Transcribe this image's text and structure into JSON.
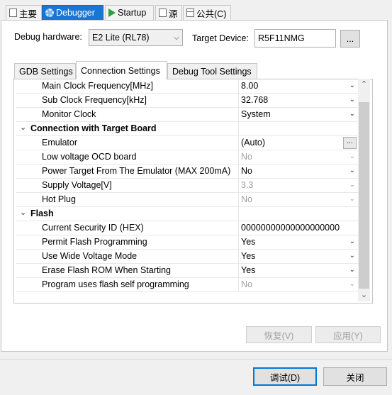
{
  "top_tabs": [
    {
      "label": "主要",
      "icon": "document-icon",
      "active": false
    },
    {
      "label": "Debugger",
      "icon": "bug-gear-icon",
      "active": true
    },
    {
      "label": "Startup",
      "icon": "play-icon",
      "active": false
    },
    {
      "label": "源",
      "icon": "document-icon",
      "active": false
    },
    {
      "label": "公共(C)",
      "icon": "grid-icon",
      "active": false
    }
  ],
  "debug_hardware": {
    "label": "Debug hardware:",
    "value": "E2 Lite (RL78)"
  },
  "target_device": {
    "label": "Target Device:",
    "value": "R5F11NMG",
    "browse_label": "..."
  },
  "inner_tabs": [
    {
      "label": "GDB Settings",
      "active": false
    },
    {
      "label": "Connection Settings",
      "active": true
    },
    {
      "label": "Debug Tool Settings",
      "active": false
    }
  ],
  "rows": [
    {
      "type": "prop",
      "name": "Main Clock Frequency[MHz]",
      "value": "8.00",
      "control": "dropdown",
      "disabled": false
    },
    {
      "type": "prop",
      "name": "Sub Clock Frequency[kHz]",
      "value": "32.768",
      "control": "dropdown",
      "disabled": false
    },
    {
      "type": "prop",
      "name": "Monitor Clock",
      "value": "System",
      "control": "dropdown",
      "disabled": false
    },
    {
      "type": "category",
      "name": "Connection with Target Board",
      "expanded": true
    },
    {
      "type": "prop",
      "name": "Emulator",
      "value": "(Auto)",
      "control": "browse",
      "disabled": false
    },
    {
      "type": "prop",
      "name": "Low voltage OCD board",
      "value": "No",
      "control": "dropdown",
      "disabled": true
    },
    {
      "type": "prop",
      "name": "Power Target From The Emulator (MAX 200mA)",
      "value": "No",
      "control": "dropdown",
      "disabled": false
    },
    {
      "type": "prop",
      "name": "Supply Voltage[V]",
      "value": "3.3",
      "control": "dropdown",
      "disabled": true
    },
    {
      "type": "prop",
      "name": "Hot Plug",
      "value": "No",
      "control": "dropdown",
      "disabled": true
    },
    {
      "type": "category",
      "name": "Flash",
      "expanded": true
    },
    {
      "type": "prop",
      "name": "Current Security ID (HEX)",
      "value": "00000000000000000000",
      "control": "text",
      "disabled": false
    },
    {
      "type": "prop",
      "name": "Permit Flash Programming",
      "value": "Yes",
      "control": "dropdown",
      "disabled": false
    },
    {
      "type": "prop",
      "name": "Use Wide Voltage Mode",
      "value": "Yes",
      "control": "dropdown",
      "disabled": false
    },
    {
      "type": "prop",
      "name": "Erase Flash ROM When Starting",
      "value": "Yes",
      "control": "dropdown",
      "disabled": false
    },
    {
      "type": "prop",
      "name": "Program uses flash self programming",
      "value": "No",
      "control": "dropdown",
      "disabled": true
    }
  ],
  "buttons": {
    "revert": "恢复(V)",
    "apply": "应用(Y)",
    "debug": "调试(D)",
    "close": "关闭"
  }
}
